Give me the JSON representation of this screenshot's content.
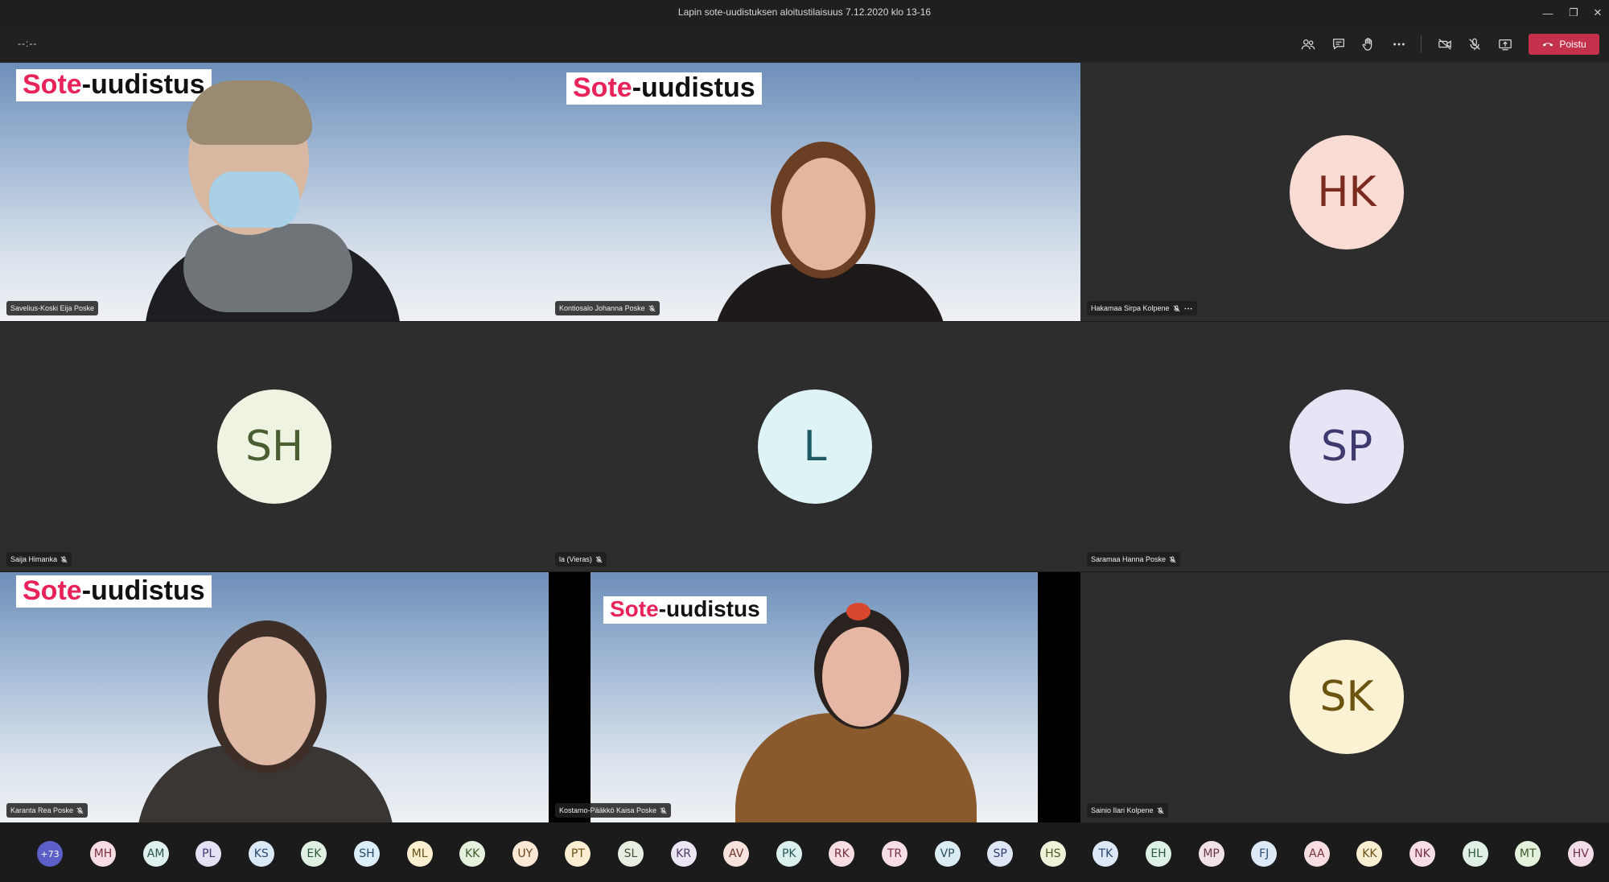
{
  "window": {
    "title": "Lapin sote-uudistuksen aloitustilaisuus 7.12.2020 klo 13-16",
    "minimize_glyph": "—",
    "restore_glyph": "❐",
    "close_glyph": "✕"
  },
  "toolbar": {
    "timer": "--:--",
    "leave_label": "Poistu",
    "leave_color": "#c4314b",
    "icons": [
      "participants-icon",
      "chat-icon",
      "raise-hand-icon",
      "more-icon",
      "camera-off-icon",
      "mic-off-icon",
      "share-icon"
    ]
  },
  "banner": {
    "part1": "Sote",
    "part2": "-uudistus"
  },
  "tiles": [
    {
      "name": "Savelius-Koski Eija Poske",
      "type": "video"
    },
    {
      "name": "Kontiosalo Johanna Poske",
      "type": "video"
    },
    {
      "name": "Hakamaa Sirpa Kolpene",
      "type": "avatar",
      "initials": "HK",
      "bg": "#f8dcd4",
      "fg": "#7a2b1e"
    },
    {
      "name": "Saija Himanka",
      "type": "avatar",
      "initials": "SH",
      "bg": "#eef4e1",
      "fg": "#4b5e31"
    },
    {
      "name": "la (Vieras)",
      "type": "avatar",
      "initials": "L",
      "bg": "#ddf3f6",
      "fg": "#1e5a63"
    },
    {
      "name": "Saramaa Hanna Poske",
      "type": "avatar",
      "initials": "SP",
      "bg": "#e7e4f6",
      "fg": "#3e3a6e"
    },
    {
      "name": "Karanta Rea Poske",
      "type": "video"
    },
    {
      "name": "Kostamo-Pääkkö Kaisa Poske",
      "type": "video"
    },
    {
      "name": "Sainio Ilari Kolpene",
      "type": "avatar",
      "initials": "SK",
      "bg": "#fbf2d3",
      "fg": "#6b5310"
    }
  ],
  "gallery": {
    "more_label": "+73",
    "participants": [
      {
        "initials": "MH",
        "bg": "#f6dde3",
        "fg": "#7b2d3e"
      },
      {
        "initials": "AM",
        "bg": "#dff0ee",
        "fg": "#27554f"
      },
      {
        "initials": "PL",
        "bg": "#e4e1f5",
        "fg": "#3d3873"
      },
      {
        "initials": "KS",
        "bg": "#dbe9f7",
        "fg": "#264a70"
      },
      {
        "initials": "EK",
        "bg": "#e0f1e4",
        "fg": "#2f5a39"
      },
      {
        "initials": "SH",
        "bg": "#dceef8",
        "fg": "#244b63"
      },
      {
        "initials": "ML",
        "bg": "#fbefd2",
        "fg": "#6b5012"
      },
      {
        "initials": "KK",
        "bg": "#e5f1dc",
        "fg": "#3f5a2a"
      },
      {
        "initials": "UY",
        "bg": "#fbe8d4",
        "fg": "#6e4317"
      },
      {
        "initials": "PT",
        "bg": "#fbeed3",
        "fg": "#6c4f12"
      },
      {
        "initials": "SL",
        "bg": "#e8eee2",
        "fg": "#445338"
      },
      {
        "initials": "KR",
        "bg": "#ece5f3",
        "fg": "#4b3966"
      },
      {
        "initials": "AV",
        "bg": "#f7e2dd",
        "fg": "#6f3428"
      },
      {
        "initials": "PK",
        "bg": "#dcefef",
        "fg": "#275858"
      },
      {
        "initials": "RK",
        "bg": "#f6dde2",
        "fg": "#76303f"
      },
      {
        "initials": "TR",
        "bg": "#f7dde6",
        "fg": "#783049"
      },
      {
        "initials": "VP",
        "bg": "#dcecf3",
        "fg": "#284f62"
      },
      {
        "initials": "SP",
        "bg": "#dfe6f6",
        "fg": "#2f3f70"
      },
      {
        "initials": "HS",
        "bg": "#edf2d9",
        "fg": "#4c5a22"
      },
      {
        "initials": "TK",
        "bg": "#dde8f6",
        "fg": "#2a4570"
      },
      {
        "initials": "EH",
        "bg": "#ddf1e6",
        "fg": "#2a5a40"
      },
      {
        "initials": "MP",
        "bg": "#f0e2e6",
        "fg": "#6a3545"
      },
      {
        "initials": "FJ",
        "bg": "#dde9f6",
        "fg": "#2b4a6e"
      },
      {
        "initials": "AA",
        "bg": "#f7dee0",
        "fg": "#75303a"
      },
      {
        "initials": "KK",
        "bg": "#f8efd3",
        "fg": "#6a5216"
      },
      {
        "initials": "NK",
        "bg": "#f6dde6",
        "fg": "#773049"
      },
      {
        "initials": "HL",
        "bg": "#e1f0e4",
        "fg": "#305a3a"
      },
      {
        "initials": "MT",
        "bg": "#e4f1dc",
        "fg": "#3e5a29"
      },
      {
        "initials": "HV",
        "bg": "#f3dde8",
        "fg": "#6f2f4e"
      }
    ]
  }
}
